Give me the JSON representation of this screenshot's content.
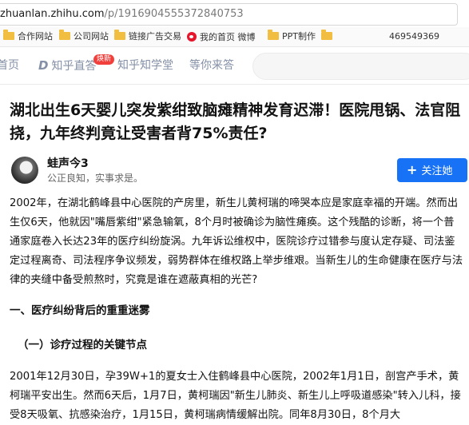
{
  "browser": {
    "url_host": "zhuanlan.zhihu.com",
    "url_path": "/p/1916904555372840753",
    "bookmarks": [
      {
        "label": "合作网站",
        "icon": "folder-icon"
      },
      {
        "label": "公司网站",
        "icon": "folder-icon"
      },
      {
        "label": "链接广告交易",
        "icon": "folder-icon"
      },
      {
        "label": "我的首页 微博",
        "icon": "weibo-icon"
      },
      {
        "label": "PPT制作",
        "icon": "folder-icon"
      },
      {
        "label": "",
        "icon": "folder-icon"
      },
      {
        "label": "469549369",
        "icon": ""
      }
    ]
  },
  "nav": {
    "items": [
      "首页",
      "知乎直答",
      "知乎知学堂",
      "等你来答"
    ],
    "badge": "焕新"
  },
  "article": {
    "title": "湖北出生6天婴儿突发紫绀致脑瘫精神发育迟滞！医院甩锅、法官阻挠，九年终判竟让受害者背75%责任?",
    "author": "蛙声今3",
    "bio": "公正良知，实事求是。",
    "follow_label": "关注她",
    "intro": "2002年，在湖北鹤峰县中心医院的产房里，新生儿黄柯瑞的啼哭本应是家庭幸福的开端。然而出生仅6天，他就因\"嘴唇紫绀\"紧急输氧，8个月时被确诊为脑性瘫痪。这个残酷的诊断，将一个普通家庭卷入长达23年的医疗纠纷旋涡。九年诉讼维权中，医院诊疗过错参与度认定存疑、司法鉴定过程离奇、司法程序争议频发，弱势群体在维权路上举步维艰。当新生儿的生命健康在医疗与法律的夹缝中备受煎熬时，究竟是谁在遮蔽真相的光芒?",
    "section1": "一、医疗纠纷背后的重重迷雾",
    "subsection1": "（一）诊疗过程的关键节点",
    "para2": "2001年12月30日，孕39W+1的夏女士入住鹤峰县中心医院，2002年1月1日，剖宫产手术，黄柯瑞平安出生。然而6天后，1月7日，黄柯瑞因\"新生儿肺炎、新生儿上呼吸道感染\"转入儿科，接受8天吸氧、抗感染治疗，1月15日，黄柯瑞病情缓解出院。同年8月30日，8个月大"
  }
}
